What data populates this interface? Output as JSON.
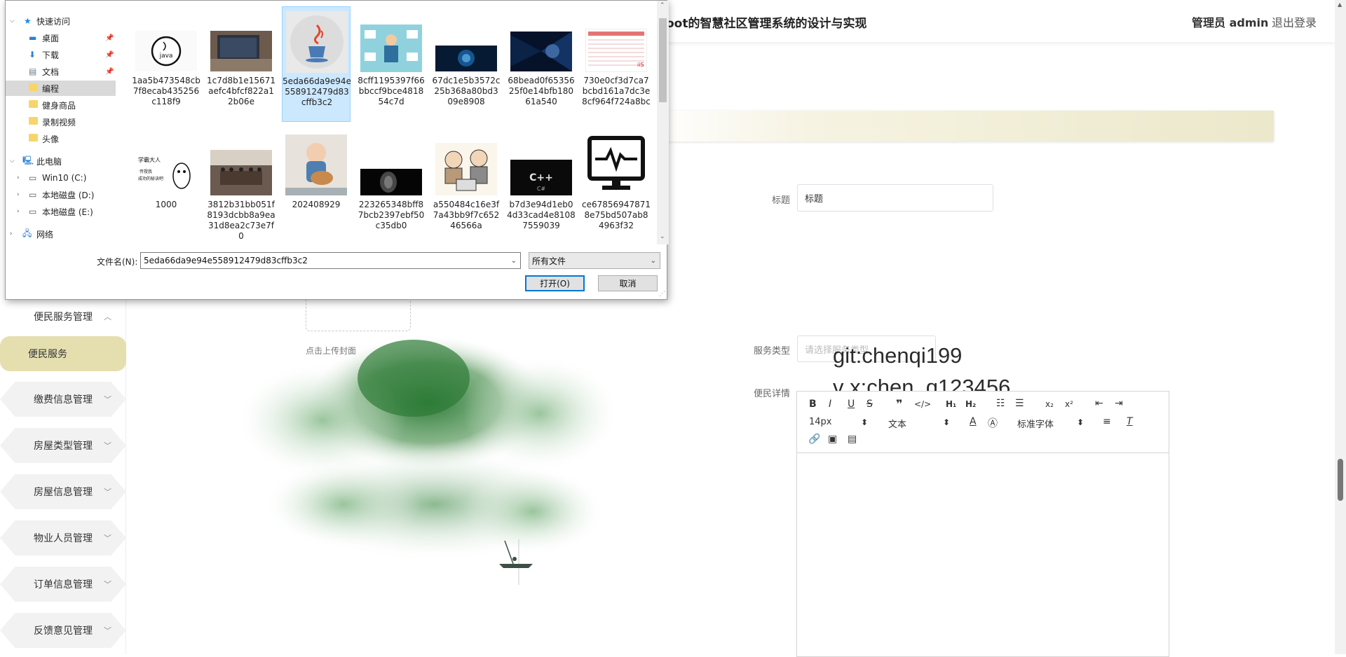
{
  "app": {
    "title": "oot的智慧社区管理系统的设计与实现",
    "user_label": "管理员 admin",
    "logout_label": "退出登录"
  },
  "sidebar": {
    "items": [
      {
        "label": "便民服务管理",
        "expanded": true
      },
      {
        "label": "便民服务",
        "active": true
      },
      {
        "label": "缴费信息管理"
      },
      {
        "label": "房屋类型管理"
      },
      {
        "label": "房屋信息管理"
      },
      {
        "label": "物业人员管理"
      },
      {
        "label": "订单信息管理"
      },
      {
        "label": "反馈意见管理"
      }
    ]
  },
  "form": {
    "title_label": "标题",
    "title_value": "标题",
    "upload_hint": "点击上传封面",
    "service_type_label": "服务类型",
    "service_type_placeholder": "请选择服务类型",
    "detail_label": "便民详情"
  },
  "watermark": {
    "line1": "git:chenqi199",
    "line2": "v x:chen_q123456"
  },
  "editor": {
    "font_size": "14px",
    "block_type": "文本",
    "font_family": "标准字体"
  },
  "dialog": {
    "nav": [
      {
        "label": "快速访问",
        "icon": "star-icon",
        "level": 0
      },
      {
        "label": "桌面",
        "icon": "desktop-icon",
        "level": 1,
        "pinned": true
      },
      {
        "label": "下载",
        "icon": "download-icon",
        "level": 1,
        "pinned": true
      },
      {
        "label": "文档",
        "icon": "document-icon",
        "level": 1,
        "pinned": true
      },
      {
        "label": "编程",
        "icon": "folder-icon",
        "level": 1,
        "selected": true
      },
      {
        "label": "健身商品",
        "icon": "folder-icon",
        "level": 1
      },
      {
        "label": "录制视频",
        "icon": "folder-icon",
        "level": 1
      },
      {
        "label": "头像",
        "icon": "folder-icon",
        "level": 1
      },
      {
        "label": "此电脑",
        "icon": "computer-icon",
        "level": 0
      },
      {
        "label": "Win10 (C:)",
        "icon": "drive-icon",
        "level": 1
      },
      {
        "label": "本地磁盘 (D:)",
        "icon": "drive-icon",
        "level": 1
      },
      {
        "label": "本地磁盘 (E:)",
        "icon": "drive-icon",
        "level": 1
      },
      {
        "label": "网络",
        "icon": "network-icon",
        "level": 0
      }
    ],
    "files": [
      {
        "name": "1aa5b473548cb7f8ecab435256c118f9",
        "thumb": "java-logo"
      },
      {
        "name": "1c7d8b1e15671aefc4bfcf822a12b06e",
        "thumb": "laptop"
      },
      {
        "name": "5eda66da9e94e558912479d83cffb3c2",
        "thumb": "java-cup",
        "selected": true
      },
      {
        "name": "8cff1195397f66bbccf9bce481854c7d",
        "thumb": "multitask-person"
      },
      {
        "name": "67dc1e5b3572c25b368a80bd309e8908",
        "thumb": "ai-brain"
      },
      {
        "name": "68bead0f6535625f0e14bfb18061a540",
        "thumb": "code-tunnel"
      },
      {
        "name": "730e0cf3d7ca7bcbd161a7dc3e8cf964f724a8bc",
        "thumb": "spreadsheet"
      },
      {
        "name": "1000",
        "thumb": "cartoon-cat"
      },
      {
        "name": "3812b31bb051f8193dcbb8a9ea31d8ea2c73e7f0",
        "thumb": "meeting-room"
      },
      {
        "name": "202408929",
        "thumb": "child-guitar"
      },
      {
        "name": "223265348bff87bcb2397ebf50c35db0",
        "thumb": "dark-face"
      },
      {
        "name": "a550484c16e3f7a43bb9f7c65246566a",
        "thumb": "cartoon-people"
      },
      {
        "name": "b7d3e94d1eb04d33cad4e81087559039",
        "thumb": "cpp-logo"
      },
      {
        "name": "ce67856947871 8e75bd507ab84963f32",
        "thumb": "monitor-heartbeat"
      }
    ],
    "filename_label": "文件名(N):",
    "filename_value": "5eda66da9e94e558912479d83cffb3c2",
    "filetype_value": "所有文件",
    "open_label": "打开(O)",
    "cancel_label": "取消"
  }
}
